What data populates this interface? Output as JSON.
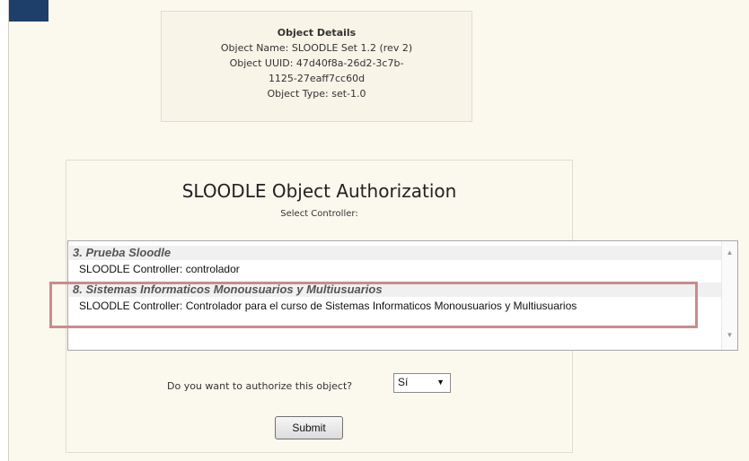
{
  "object_details": {
    "title": "Object Details",
    "name_line": "Object Name: SLOODLE Set 1.2 (rev 2)",
    "uuid_line_1": "Object UUID: 47d40f8a-26d2-3c7b-",
    "uuid_line_2": "1125-27eaff7cc60d",
    "type_line": "Object Type: set-1.0"
  },
  "authorization": {
    "title": "SLOODLE Object Authorization",
    "select_label": "Select Controller:",
    "groups": [
      {
        "label": "3. Prueba Sloodle",
        "options": [
          "SLOODLE Controller: controlador"
        ]
      },
      {
        "label": "8. Sistemas Informaticos Monousuarios y Multiusuarios",
        "options": [
          "SLOODLE Controller: Controlador para el curso de Sistemas Informaticos Monousuarios y Multiusuarios"
        ]
      }
    ],
    "question": "Do you want to authorize this object?",
    "answer_value": "Sí",
    "submit_label": "Submit"
  },
  "colors": {
    "page_background": "#fbf8ee",
    "corner_tab": "#1f3f6b",
    "highlight_border": "#c98c8c"
  }
}
